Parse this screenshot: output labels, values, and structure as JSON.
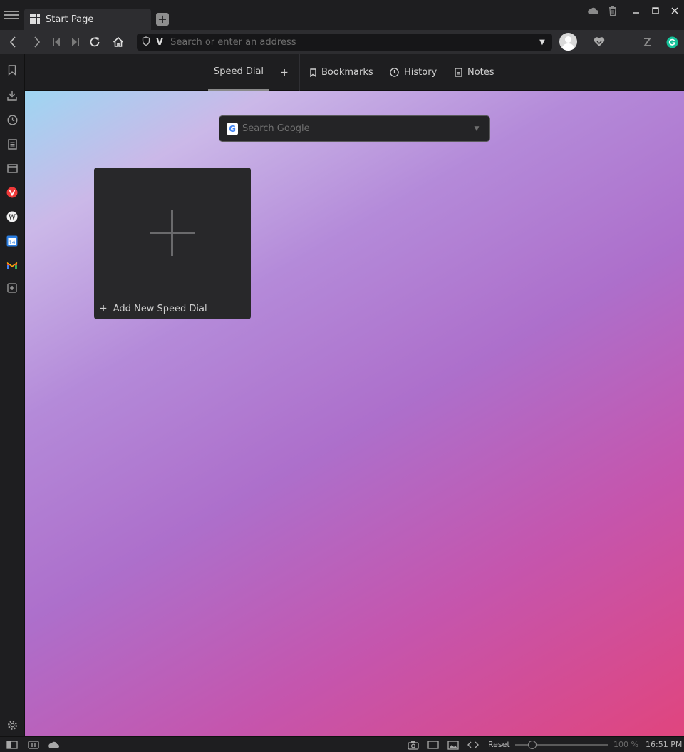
{
  "window": {
    "tab_title": "Start Page",
    "new_tab_label": "+"
  },
  "address": {
    "placeholder": "Search or enter an address",
    "logo": "V"
  },
  "startpage": {
    "tabs": [
      {
        "label": "Speed Dial",
        "icon": "none"
      },
      {
        "label": "+",
        "icon": "plus-icon"
      },
      {
        "label": "Bookmarks",
        "icon": "bookmark-icon"
      },
      {
        "label": "History",
        "icon": "clock-icon"
      },
      {
        "label": "Notes",
        "icon": "note-icon"
      }
    ],
    "search_placeholder": "Search Google",
    "search_engine_logo": "G",
    "add_dial_label": "Add New Speed Dial",
    "add_dial_glyph": "+"
  },
  "statusbar": {
    "reset_label": "Reset",
    "zoom_label": "100 %",
    "zoom_percent": 100,
    "clock": "16:51 PM"
  },
  "colors": {
    "chrome_bg": "#1e1e20",
    "toolbar_bg": "#2d2d30",
    "gradient_start": "#9ed6f2",
    "gradient_mid": "#ad6fcb",
    "gradient_end": "#e0457e"
  }
}
